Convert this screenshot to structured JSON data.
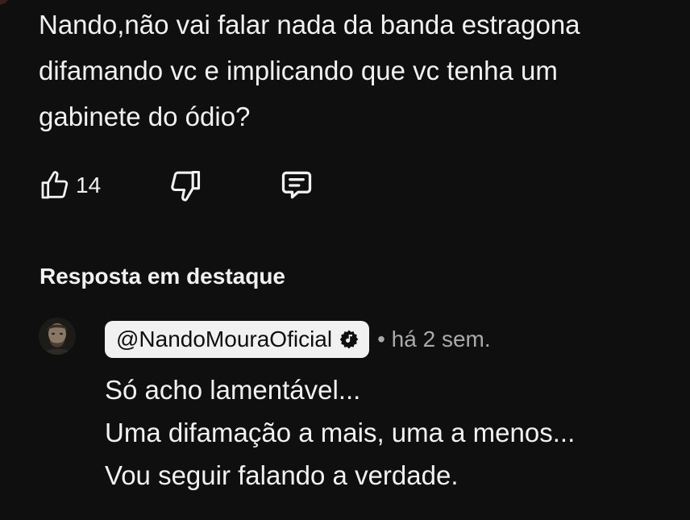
{
  "comment": {
    "lines": [
      "Nando,não vai falar nada da banda estragona",
      "difamando vc e implicando que vc tenha um",
      "gabinete do ódio?"
    ],
    "like_count": "14",
    "icons": {
      "like": "thumbs-up-icon",
      "dislike": "thumbs-down-icon",
      "reply": "comment-icon"
    }
  },
  "highlighted_reply": {
    "heading": "Resposta em destaque",
    "author": "@NandoMouraOficial",
    "time": "• há 2 sem.",
    "lines": [
      "Só acho lamentável...",
      "Uma difamação a mais, uma a menos...",
      "Vou seguir falando a verdade."
    ]
  },
  "colors": {
    "background": "#0f0f0f",
    "text": "#f1f1f1",
    "secondary_text": "#aaaaaa",
    "author_chip_bg": "#f1f1f1"
  }
}
